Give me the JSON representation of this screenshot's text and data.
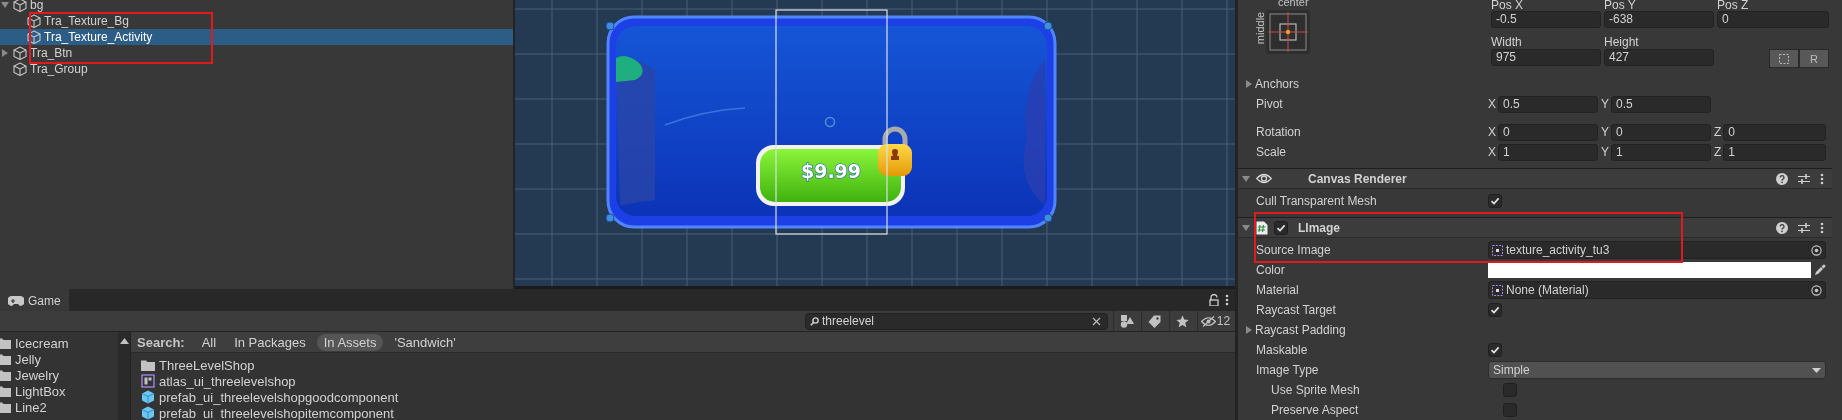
{
  "hierarchy": {
    "items": [
      {
        "name": "bg",
        "expanded": true,
        "selected": false,
        "children": [
          {
            "name": "Tra_Texture_Bg",
            "selected": false
          },
          {
            "name": "Tra_Texture_Activity",
            "selected": true
          }
        ]
      },
      {
        "name": "Tra_Btn",
        "expanded": false,
        "selected": false
      },
      {
        "name": "Tra_Group",
        "selected": false
      }
    ]
  },
  "scene": {
    "price_label": "$9.99"
  },
  "project": {
    "tab": "Game",
    "search": {
      "value": "threelevel"
    },
    "hidden_count": "12",
    "folders": [
      "Icecream",
      "Jelly",
      "Jewelry",
      "LightBox",
      "Line2"
    ],
    "search_label": "Search:",
    "scopes": [
      {
        "label": "All",
        "selected": false
      },
      {
        "label": "In Packages",
        "selected": false
      },
      {
        "label": "In Assets",
        "selected": true
      },
      {
        "label": "'Sandwich'",
        "selected": false
      }
    ],
    "results": [
      {
        "name": "ThreeLevelShop",
        "kind": "folder"
      },
      {
        "name": "atlas_ui_threelevelshop",
        "kind": "atlas"
      },
      {
        "name": "prefab_ui_threelevelshopgoodcomponent",
        "kind": "prefab"
      },
      {
        "name": "prefab_ui_threelevelshopitemcomponent",
        "kind": "prefab"
      }
    ]
  },
  "inspector": {
    "anchor": {
      "horizontal": "center",
      "vertical": "middle"
    },
    "position": [
      {
        "label": "Pos X",
        "value": "-0.5"
      },
      {
        "label": "Pos Y",
        "value": "-638"
      },
      {
        "label": "Pos Z",
        "value": "0"
      }
    ],
    "size": [
      {
        "label": "Width",
        "value": "975"
      },
      {
        "label": "Height",
        "value": "427"
      }
    ],
    "raw_button": "R",
    "rows": [
      {
        "label": "Anchors",
        "kind": "foldout",
        "expanded": false
      },
      {
        "label": "Pivot",
        "kind": "vector",
        "fields": [
          {
            "axis": "X",
            "value": "0.5"
          },
          {
            "axis": "Y",
            "value": "0.5"
          }
        ]
      },
      {
        "label": "Rotation",
        "kind": "vector",
        "fields": [
          {
            "axis": "X",
            "value": "0"
          },
          {
            "axis": "Y",
            "value": "0"
          },
          {
            "axis": "Z",
            "value": "0"
          }
        ]
      },
      {
        "label": "Scale",
        "kind": "vector",
        "fields": [
          {
            "axis": "X",
            "value": "1"
          },
          {
            "axis": "Y",
            "value": "1"
          },
          {
            "axis": "Z",
            "value": "1"
          }
        ]
      }
    ],
    "components": [
      {
        "title": "Canvas Renderer",
        "kind": "renderer",
        "expanded": true,
        "fields": [
          {
            "label": "Cull Transparent Mesh",
            "kind": "checkbox",
            "checked": true
          }
        ]
      },
      {
        "title": "LImage",
        "kind": "script",
        "expanded": true,
        "enabled": true,
        "fields": [
          {
            "label": "Source Image",
            "kind": "object",
            "value": "texture_activity_tu3"
          },
          {
            "label": "Color",
            "kind": "color",
            "color": "#ffffff"
          },
          {
            "label": "Material",
            "kind": "object",
            "value": "None (Material)"
          },
          {
            "label": "Raycast Target",
            "kind": "checkbox",
            "checked": true
          },
          {
            "label": "Raycast Padding",
            "kind": "foldout",
            "expanded": false
          },
          {
            "label": "Maskable",
            "kind": "checkbox",
            "checked": true
          },
          {
            "label": "Image Type",
            "kind": "dropdown",
            "value": "Simple",
            "children": [
              {
                "label": "Use Sprite Mesh",
                "kind": "checkbox",
                "checked": false
              },
              {
                "label": "Preserve Aspect",
                "kind": "checkbox",
                "checked": false
              }
            ]
          }
        ]
      }
    ]
  }
}
